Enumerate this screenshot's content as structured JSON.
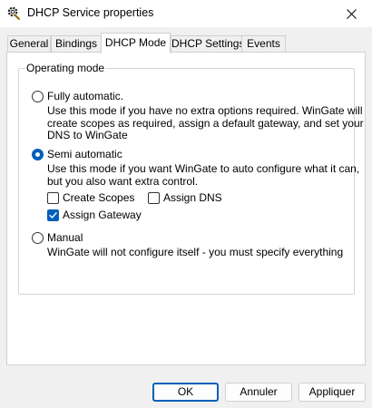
{
  "window": {
    "title": "DHCP Service properties",
    "icon": "gear-service-icon",
    "close_icon": "close-icon"
  },
  "tabs": [
    {
      "label": "General",
      "active": false
    },
    {
      "label": "Bindings",
      "active": false
    },
    {
      "label": "DHCP Mode",
      "active": true
    },
    {
      "label": "DHCP Settings",
      "active": false
    },
    {
      "label": "Events",
      "active": false
    }
  ],
  "operating_mode": {
    "group_title": "Operating mode",
    "fully_automatic": {
      "label": "Fully automatic.",
      "selected": false,
      "description": [
        "Use this mode if you have no extra options required.  WinGate will",
        "create scopes as required, assign a default gateway, and set your",
        "DNS to WinGate"
      ]
    },
    "semi_automatic": {
      "label": "Semi automatic",
      "selected": true,
      "description": [
        "Use this mode if you want WinGate to auto configure what it can,",
        "but you also want extra control."
      ],
      "options": {
        "create_scopes": {
          "label": "Create Scopes",
          "checked": false
        },
        "assign_dns": {
          "label": "Assign DNS",
          "checked": false
        },
        "assign_gateway": {
          "label": "Assign Gateway",
          "checked": true
        }
      }
    },
    "manual": {
      "label": "Manual",
      "selected": false,
      "description": [
        "WinGate will not configure itself - you must specify everything"
      ]
    }
  },
  "buttons": {
    "ok": "OK",
    "cancel": "Annuler",
    "apply": "Appliquer"
  },
  "colors": {
    "accent": "#005fb8",
    "window_bg": "#f0f0f0",
    "panel_bg": "#ffffff"
  }
}
